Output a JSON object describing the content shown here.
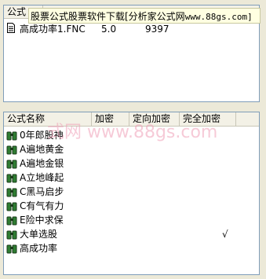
{
  "top_panel": {
    "column_header": "公式",
    "row": {
      "filename": "高成功率1.FNC",
      "version": "5.0",
      "size": "9397"
    }
  },
  "banner": {
    "text": "股票公式股票软件下载[分析家公式网",
    "site": "www.88gs.com]"
  },
  "watermark": "式网 www.88gs.com",
  "table": {
    "headers": [
      "公式名称",
      "加密",
      "定向加密",
      "完全加密"
    ],
    "rows": [
      {
        "name": "0年郎股神",
        "check": ""
      },
      {
        "name": "A遍地黄金",
        "check": ""
      },
      {
        "name": "A遍地金银",
        "check": ""
      },
      {
        "name": "A立地峰起",
        "check": ""
      },
      {
        "name": "C黑马启步",
        "check": ""
      },
      {
        "name": "C有气有力",
        "check": ""
      },
      {
        "name": "E险中求保",
        "check": ""
      },
      {
        "name": "大单选股",
        "check": "√"
      },
      {
        "name": "高成功率",
        "check": ""
      }
    ]
  },
  "colors": {
    "icon_green": "#2e7d32",
    "icon_dark": "#1b3b1b",
    "border": "#7f9db9"
  }
}
